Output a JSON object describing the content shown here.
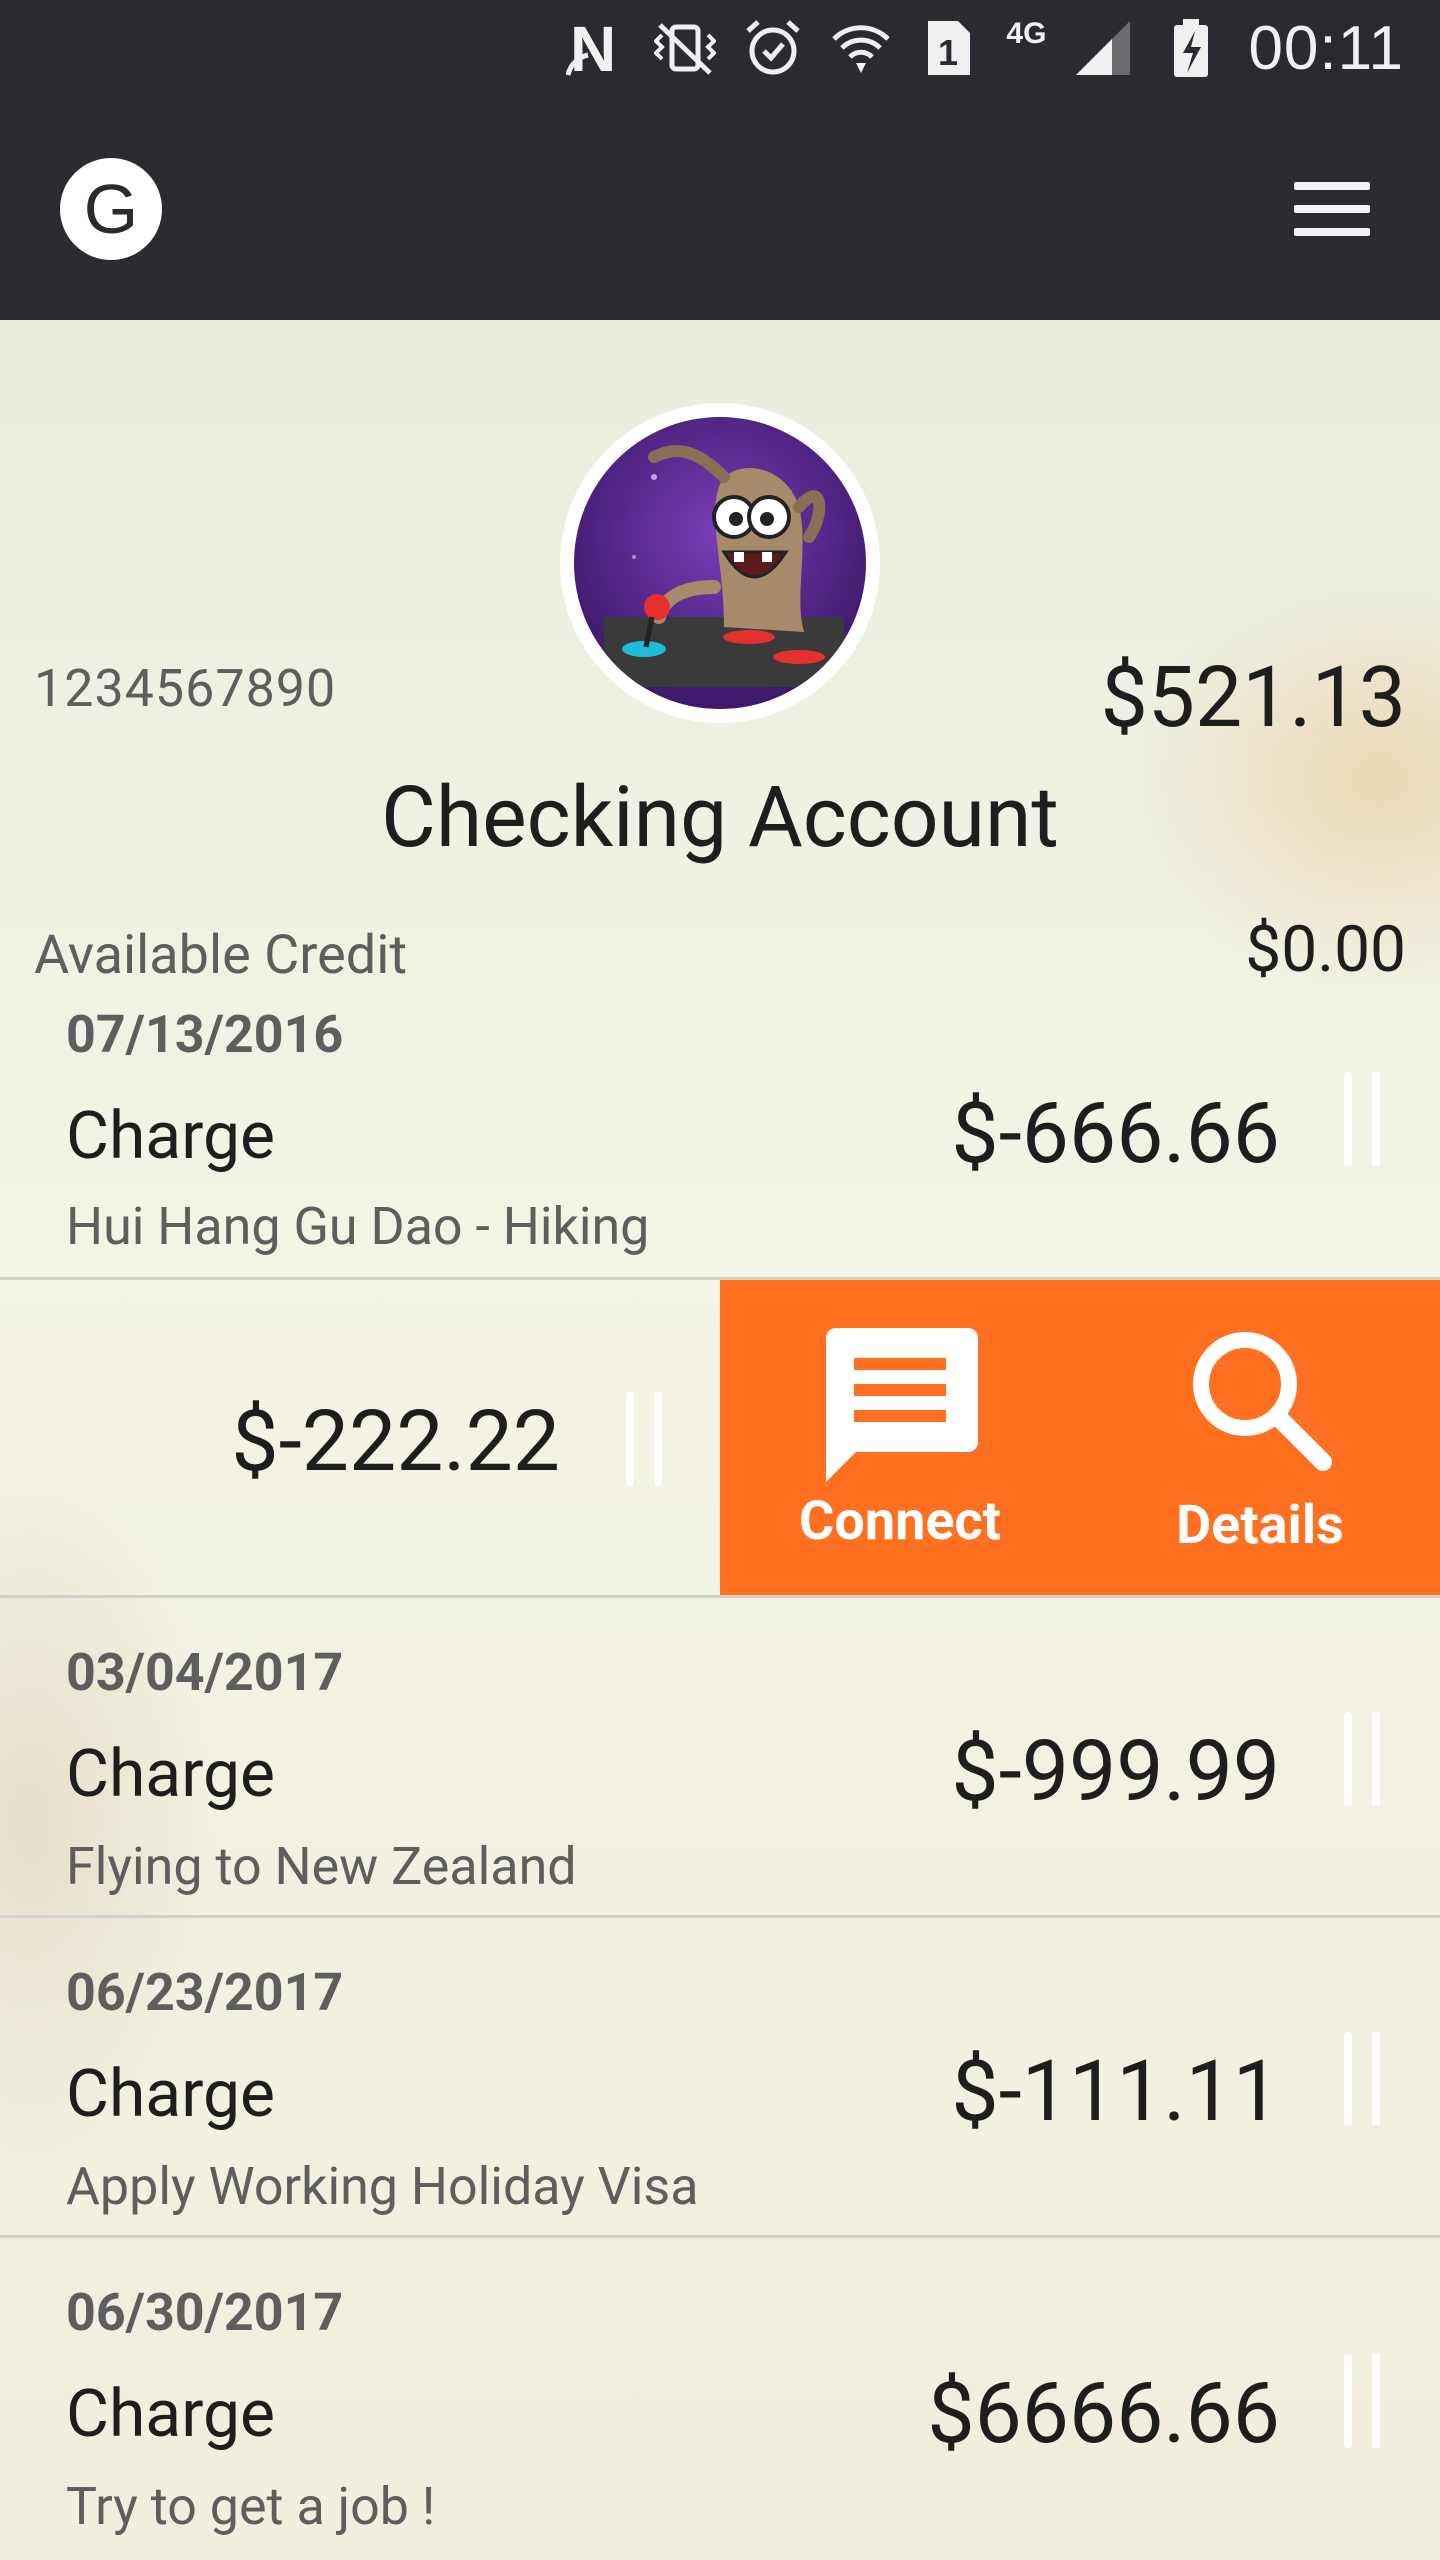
{
  "status_bar": {
    "time": "00:11",
    "network": "4G",
    "sim_slot": "1"
  },
  "app_bar": {
    "logo_letter": "G"
  },
  "account": {
    "number": "1234567890",
    "balance": "$521.13",
    "title": "Checking Account",
    "credit_label": "Available Credit",
    "credit_value": "$0.00"
  },
  "transactions": [
    {
      "date": "07/13/2016",
      "type": "Charge",
      "description": "Hui Hang Gu Dao - Hiking",
      "amount": "$-666.66"
    },
    {
      "date": "",
      "type": "",
      "description": "",
      "amount": "$-222.22"
    },
    {
      "date": "03/04/2017",
      "type": "Charge",
      "description": "Flying to New Zealand",
      "amount": "$-999.99"
    },
    {
      "date": "06/23/2017",
      "type": "Charge",
      "description": "Apply Working Holiday Visa",
      "amount": "$-111.11"
    },
    {
      "date": "06/30/2017",
      "type": "Charge",
      "description": "Try to get a job !",
      "amount": "$6666.66"
    }
  ],
  "swipe_actions": [
    {
      "label": "Connect",
      "icon": "chat-icon"
    },
    {
      "label": "Details",
      "icon": "search-icon"
    }
  ],
  "colors": {
    "bar": "#2a2b30",
    "accent": "#ff7020"
  }
}
